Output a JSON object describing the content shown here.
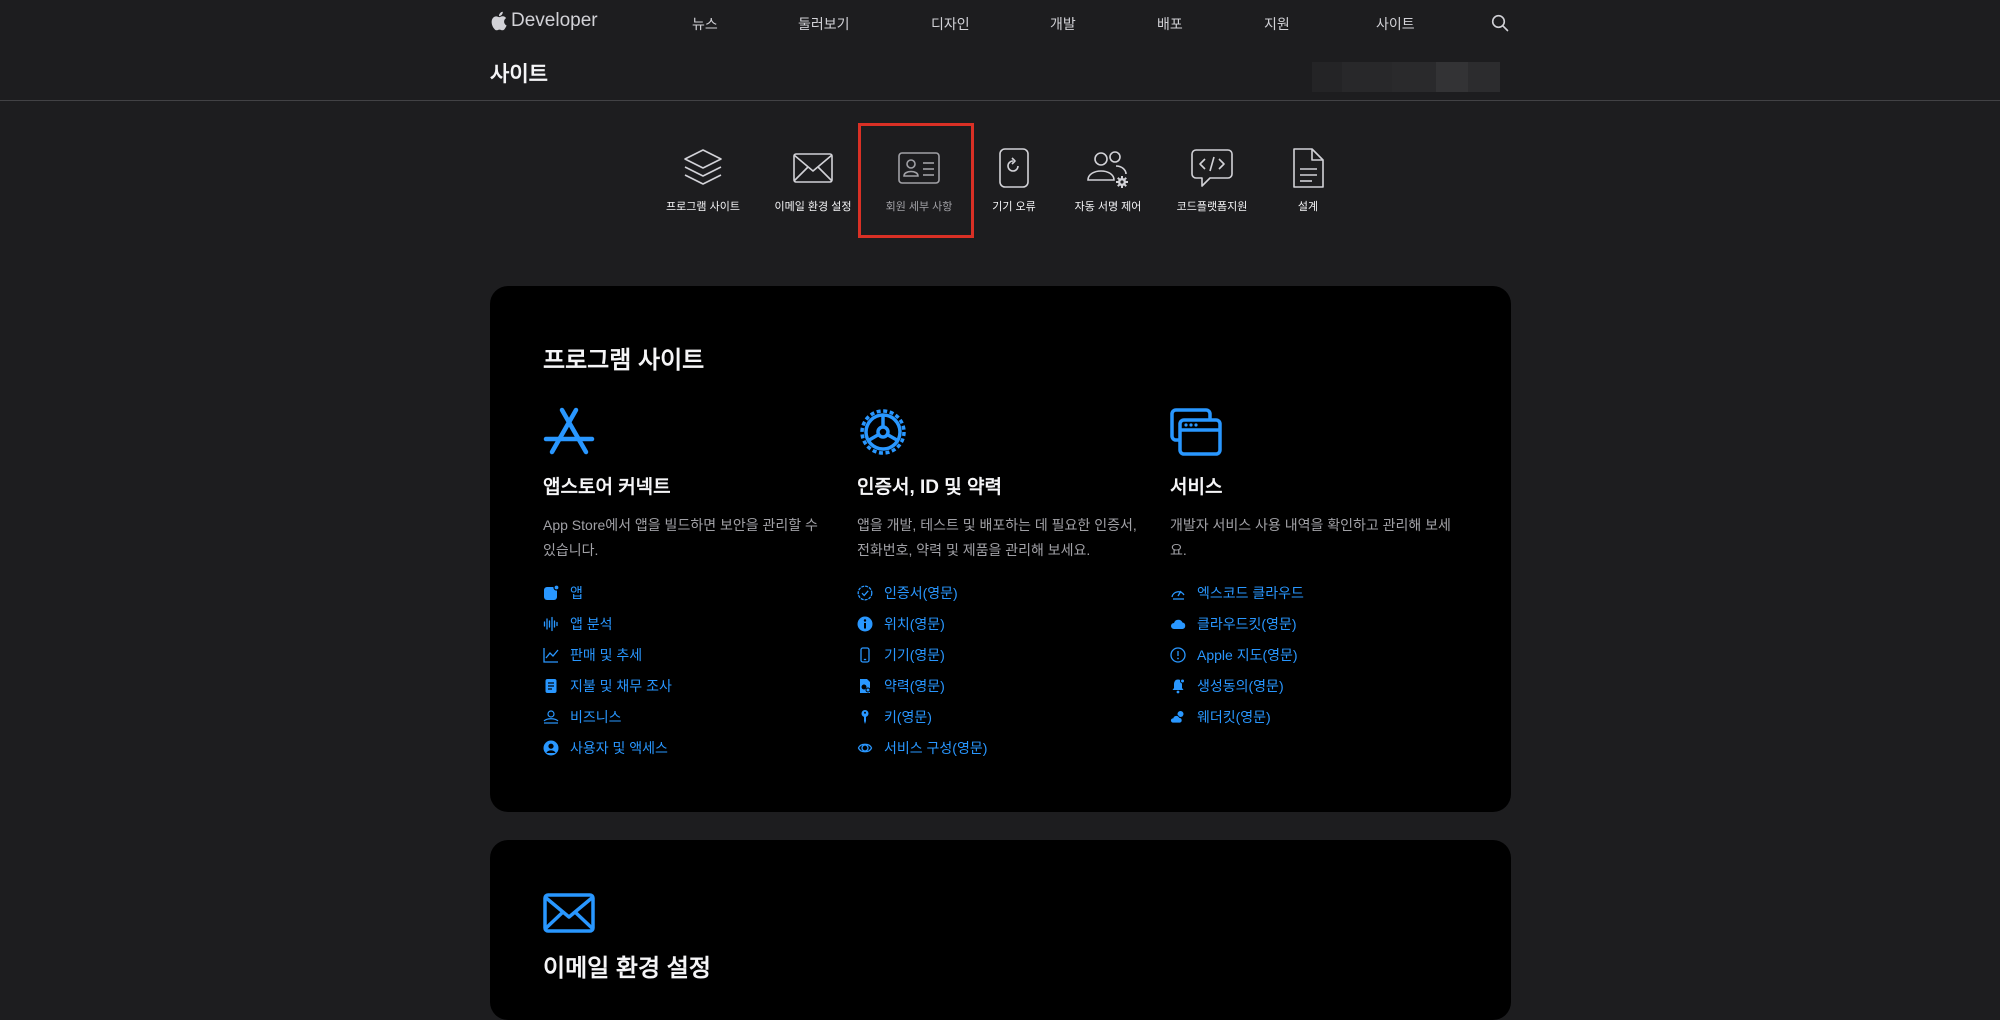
{
  "global_nav": {
    "brand": "Developer",
    "items": [
      "뉴스",
      "둘러보기",
      "디자인",
      "개발",
      "배포",
      "지원",
      "사이트"
    ]
  },
  "local_nav": {
    "title": "사이트"
  },
  "tabs": [
    {
      "label": "프로그램 사이트",
      "icon": "layers-icon",
      "active": false
    },
    {
      "label": "이메일 환경 설정",
      "icon": "envelope-icon",
      "active": false
    },
    {
      "label": "회원 세부 사항",
      "icon": "id-card-icon",
      "active": true
    },
    {
      "label": "기기 오류",
      "icon": "device-refresh-icon",
      "active": false
    },
    {
      "label": "자동 서명 제어",
      "icon": "people-gear-icon",
      "active": false
    },
    {
      "label": "코드플랫폼지원",
      "icon": "code-bubble-icon",
      "active": false
    },
    {
      "label": "설계",
      "icon": "document-icon",
      "active": false
    }
  ],
  "program_sites": {
    "title": "프로그램 사이트",
    "columns": [
      {
        "icon": "app-store-icon",
        "title": "앱스토어 커넥트",
        "description": "App Store에서 앱을 빌드하면 보안을 관리할 수 있습니다.",
        "links": [
          {
            "label": "앱",
            "icon": "app-plus-icon"
          },
          {
            "label": "앱 분석",
            "icon": "waveform-icon"
          },
          {
            "label": "판매 및 추세",
            "icon": "trend-chart-icon"
          },
          {
            "label": "지불 및 채무 조사",
            "icon": "receipt-icon"
          },
          {
            "label": "비즈니스",
            "icon": "business-icon"
          },
          {
            "label": "사용자 및 액세스",
            "icon": "user-circle-icon"
          }
        ]
      },
      {
        "icon": "gear-icon",
        "title": "인증서, ID 및 약력",
        "description": "앱을 개발, 테스트 및 배포하는 데 필요한 인증서, 전화번호, 약력 및 제품을 관리해 보세요.",
        "links": [
          {
            "label": "인증서(영문)",
            "icon": "checkmark-seal-icon"
          },
          {
            "label": "위치(영문)",
            "icon": "info-circle-icon"
          },
          {
            "label": "기기(영문)",
            "icon": "phone-icon"
          },
          {
            "label": "약력(영문)",
            "icon": "profile-doc-icon"
          },
          {
            "label": "키(영문)",
            "icon": "key-icon"
          },
          {
            "label": "서비스 구성(영문)",
            "icon": "service-config-icon"
          }
        ]
      },
      {
        "icon": "windows-icon",
        "title": "서비스",
        "description": "개발자 서비스 사용 내역을 확인하고 관리해 보세요.",
        "links": [
          {
            "label": "엑스코드 클라우드",
            "icon": "gauge-cloud-icon"
          },
          {
            "label": "클라우드킷(영문)",
            "icon": "cloud-icon"
          },
          {
            "label": "Apple 지도(영문)",
            "icon": "map-pin-circle-icon"
          },
          {
            "label": "생성동의(영문)",
            "icon": "bell-icon"
          },
          {
            "label": "웨더킷(영문)",
            "icon": "weather-icon"
          }
        ]
      }
    ]
  },
  "email_section": {
    "title": "이메일 환경 설정",
    "icon": "envelope-icon"
  },
  "colors": {
    "accent": "#2997ff",
    "background": "#1d1d1f",
    "card": "#000000",
    "highlight": "#d93025"
  }
}
